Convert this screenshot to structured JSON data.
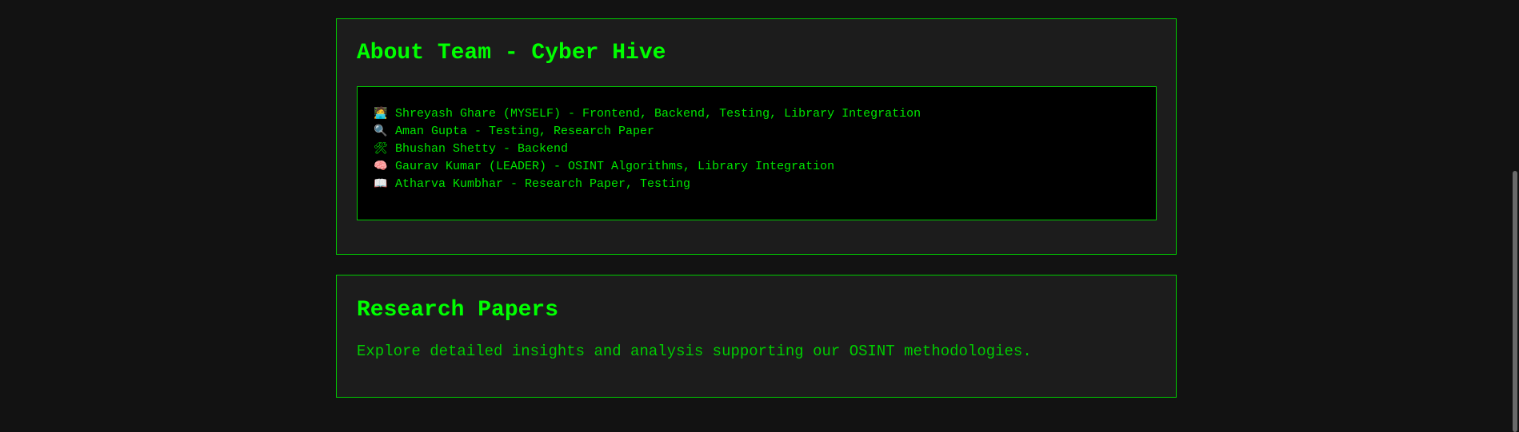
{
  "team_section": {
    "title": "About Team - Cyber Hive",
    "members": [
      {
        "icon": "technologist-icon",
        "glyph": "🧑‍💻",
        "text": "Shreyash Ghare (MYSELF) - Frontend, Backend, Testing, Library Integration"
      },
      {
        "icon": "magnifier-icon",
        "glyph": "🔍",
        "text": "Aman Gupta - Testing, Research Paper"
      },
      {
        "icon": "tools-icon",
        "glyph": "🛠",
        "text": "Bhushan Shetty - Backend"
      },
      {
        "icon": "brain-icon",
        "glyph": "🧠",
        "text": "Gaurav Kumar (LEADER) - OSINT Algorithms, Library Integration"
      },
      {
        "icon": "book-icon",
        "glyph": "📖",
        "text": "Atharva Kumbhar - Research Paper, Testing"
      }
    ]
  },
  "papers_section": {
    "title": "Research Papers",
    "description": "Explore detailed insights and analysis supporting our OSINT methodologies."
  },
  "colors": {
    "background": "#121212",
    "card_background": "#1c1c1c",
    "accent_green": "#00ff00",
    "list_background": "#000000"
  }
}
